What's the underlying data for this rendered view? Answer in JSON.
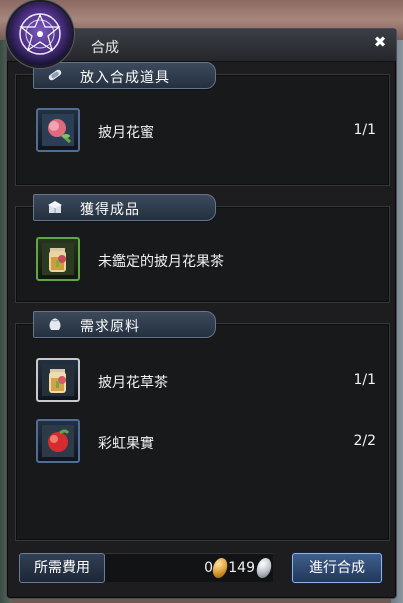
{
  "window": {
    "title": "合成",
    "close_glyph": "✖"
  },
  "sections": {
    "input": {
      "header": "放入合成道具",
      "icon": "scroll-icon",
      "items": [
        {
          "name": "披月花蜜",
          "qty": "1/1",
          "icon": "flower-honey-icon"
        }
      ]
    },
    "result": {
      "header": "獲得成品",
      "icon": "box-icon",
      "items": [
        {
          "name": "未鑑定的披月花果茶",
          "icon": "fruit-tea-jar-icon"
        }
      ]
    },
    "materials": {
      "header": "需求原料",
      "icon": "pouch-icon",
      "items": [
        {
          "name": "披月花草茶",
          "qty": "1/1",
          "icon": "herb-tea-jar-icon"
        },
        {
          "name": "彩虹果實",
          "qty": "2/2",
          "icon": "rainbow-fruit-icon"
        }
      ]
    }
  },
  "footer": {
    "fee_label": "所需費用",
    "gold_amount": "0",
    "silver_amount": "149",
    "craft_label": "進行合成"
  },
  "colors": {
    "window_bg": "#1d1d1f",
    "panel_bg": "#18191a",
    "header_blue": "#24303f",
    "slot_blue_border": "#526d95",
    "slot_green_border": "#61a545",
    "craft_button_border": "#8fb4e8"
  }
}
